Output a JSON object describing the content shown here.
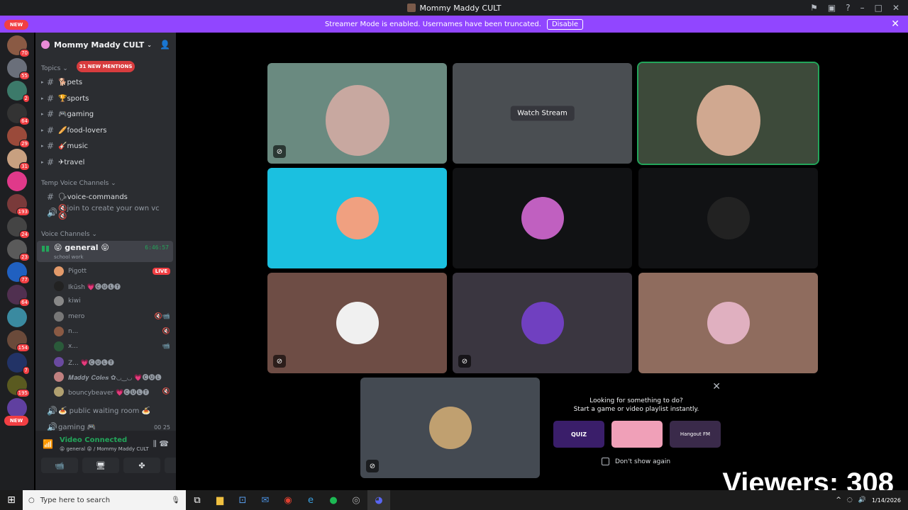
{
  "window": {
    "title": "Mommy Maddy CULT"
  },
  "streamer_banner": {
    "text": "Streamer Mode is enabled. Usernames have been truncated.",
    "button": "Disable"
  },
  "server_rail": {
    "new_top": "NEW",
    "new_bottom": "NEW",
    "servers": [
      {
        "badge": "70",
        "color": "#8a5a44"
      },
      {
        "badge": "55",
        "color": "#6a6f7a"
      },
      {
        "badge": "2",
        "color": "#3c7a6a"
      },
      {
        "badge": "64",
        "color": "#333"
      },
      {
        "badge": "29",
        "color": "#9a4a3a"
      },
      {
        "badge": "31",
        "color": "#c8a080"
      },
      {
        "badge": "",
        "color": "#e0398a"
      },
      {
        "badge": "193",
        "color": "#7a3a3a"
      },
      {
        "badge": "24",
        "color": "#444"
      },
      {
        "badge": "23",
        "color": "#5a5a5a"
      },
      {
        "badge": "77",
        "color": "#2060c0"
      },
      {
        "badge": "64",
        "color": "#503050"
      },
      {
        "badge": "",
        "color": "#3a8aa0"
      },
      {
        "badge": "154",
        "color": "#6a4a3a"
      },
      {
        "badge": "7",
        "color": "#223366"
      },
      {
        "badge": "195",
        "color": "#5a5a20"
      },
      {
        "badge": "",
        "color": "#6040a0"
      }
    ]
  },
  "sidebar": {
    "guild_name": "Mommy Maddy CULT",
    "topics_label": "Topics",
    "mentions_pill": "31 NEW MENTIONS",
    "topic_channels": [
      "🐕pets",
      "🏆sports",
      "🎮gaming",
      "🥖food-lovers",
      "🎸music",
      "✈travel"
    ],
    "temp_label": "Temp Voice Channels",
    "temp_channels": [
      "🗣voice-commands",
      "🔇join to create your own vc 🔇"
    ],
    "voice_label": "Voice Channels",
    "active_voice": {
      "name": "😝 general 😝",
      "subtitle": "school work",
      "time": "6:46:57"
    },
    "voice_users": [
      {
        "name": "Pigott",
        "right": "LIVE",
        "color": "#e39a6a"
      },
      {
        "name": "Ikūsh 💗🅒🅤🅛🅣",
        "right": "",
        "color": "#222"
      },
      {
        "name": "kiwi",
        "right": "",
        "color": "#888"
      },
      {
        "name": "mero",
        "right": "🔇📹",
        "color": "#777"
      },
      {
        "name": "n...",
        "right": "🔇",
        "color": "#8a5a44"
      },
      {
        "name": "x...",
        "right": "📹",
        "color": "#2a5a3a"
      },
      {
        "name": "Z... 💗🅒🅤🅛🅣",
        "right": "",
        "color": "#6a4aa0"
      },
      {
        "name": "𝑴𝒂𝒅𝒅𝒚 𝑪𝒐𝒍𝒆𝒔 ✿◡‿◡ 💗🅒🅤🅛",
        "right": "",
        "color": "#c08080"
      },
      {
        "name": "bouncybeaver 💗🅒🅤🅛🅣",
        "right": "🔇",
        "color": "#b0a070"
      }
    ],
    "other_voice": [
      {
        "name": "🍝 public waiting room 🍝",
        "right": ""
      },
      {
        "name": "gaming 🎮",
        "right": "00 25"
      }
    ]
  },
  "voice_panel": {
    "status": "Video Connected",
    "location": "😝 general 😝 / Mommy Maddy CULT",
    "buttons": [
      "📹",
      "🖥",
      "✤",
      "🚀"
    ]
  },
  "stage": {
    "tiles": [
      {
        "kind": "video",
        "muted": true
      },
      {
        "kind": "stream",
        "label": "Watch Stream",
        "muted": false
      },
      {
        "kind": "video",
        "muted": false,
        "speaking": true
      },
      {
        "kind": "avatar",
        "bg": "#1bc0e0",
        "muted": false
      },
      {
        "kind": "avatar",
        "bg": "#111214",
        "muted": false
      },
      {
        "kind": "avatar",
        "bg": "#111214",
        "muted": false
      },
      {
        "kind": "avatar",
        "bg": "#6e4d45",
        "muted": true
      },
      {
        "kind": "avatar",
        "bg": "#3a3640",
        "muted": true
      },
      {
        "kind": "avatar",
        "bg": "#8f6c5e",
        "muted": false
      },
      {
        "kind": "avatar",
        "bg": "#444a52",
        "muted": true
      }
    ]
  },
  "activity_prompt": {
    "title_line1": "Looking for something to do?",
    "title_line2": "Start a game or video playlist instantly.",
    "cards": [
      "QUIZ",
      "",
      "Hangout FM"
    ],
    "dont_show": "Don't show again"
  },
  "overlay": {
    "viewers": "Viewers: 308"
  },
  "taskbar": {
    "search_placeholder": "Type here to search",
    "date": "1/14/2026"
  }
}
